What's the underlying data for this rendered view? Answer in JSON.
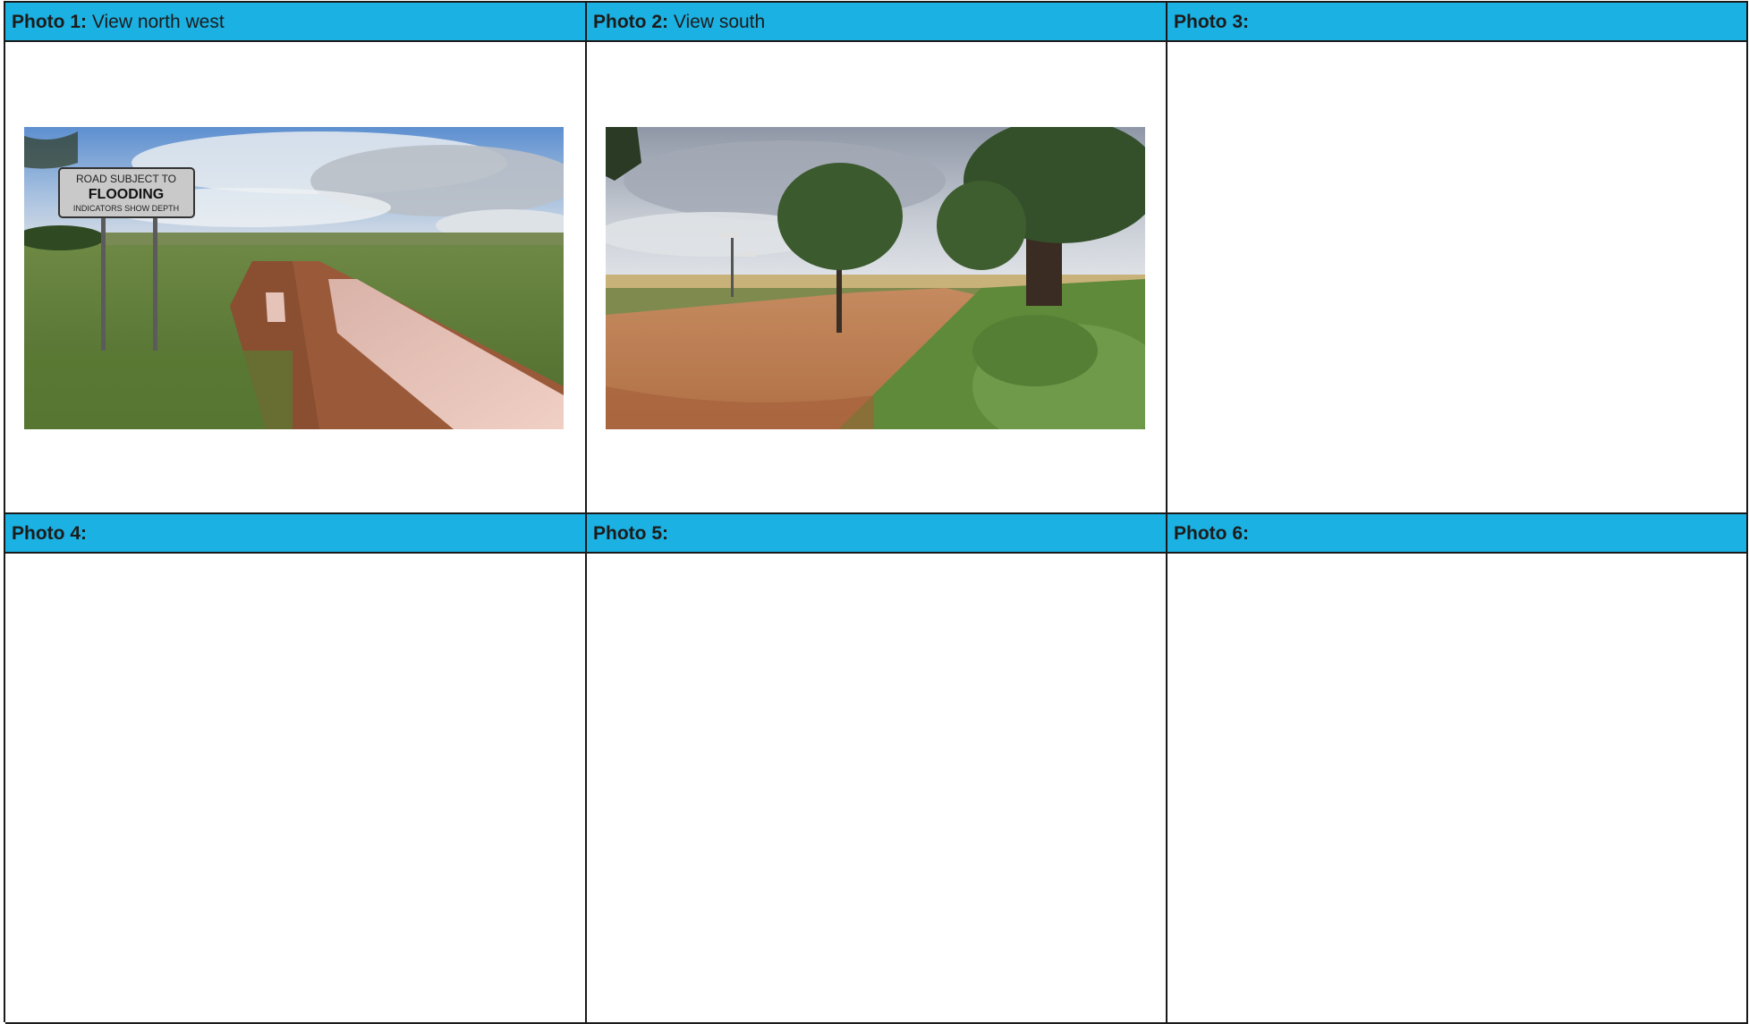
{
  "cells": [
    {
      "label": "Photo 1:",
      "caption": "View north west",
      "has_photo": true,
      "photo": {
        "name": "flooded-dirt-road-photo",
        "sign": {
          "line1": "ROAD SUBJECT TO",
          "line2": "FLOODING",
          "line3": "INDICATORS SHOW DEPTH"
        }
      }
    },
    {
      "label": "Photo 2:",
      "caption": "View south",
      "has_photo": true,
      "photo": {
        "name": "gravel-road-gum-trees-photo"
      }
    },
    {
      "label": "Photo 3:",
      "caption": "",
      "has_photo": false
    },
    {
      "label": "Photo 4:",
      "caption": "",
      "has_photo": false
    },
    {
      "label": "Photo 5:",
      "caption": "",
      "has_photo": false
    },
    {
      "label": "Photo 6:",
      "caption": "",
      "has_photo": false
    }
  ],
  "colors": {
    "header_bg": "#1bb1e2",
    "border": "#1a1a1a"
  }
}
